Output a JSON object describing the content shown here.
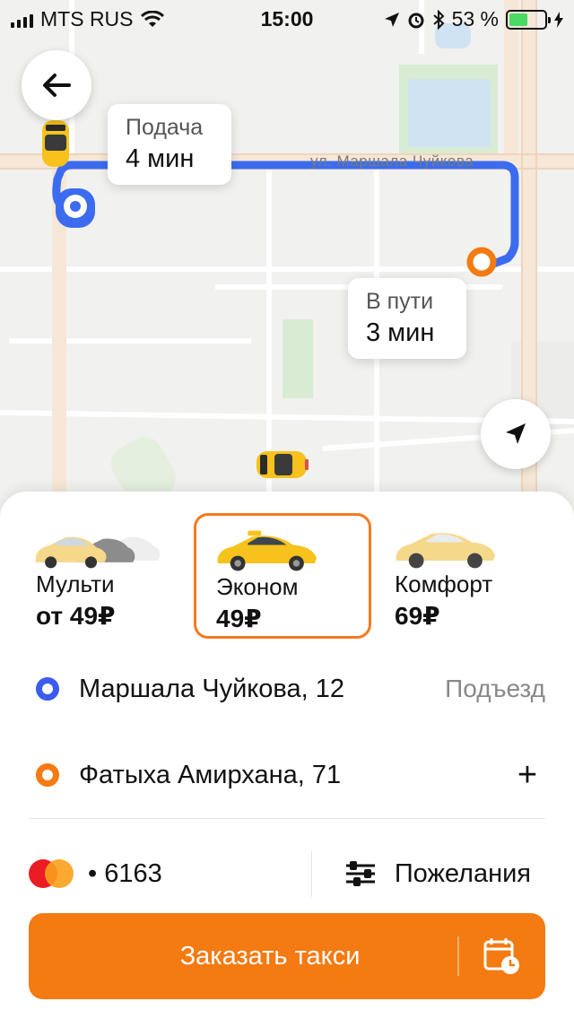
{
  "status_bar": {
    "carrier": "MTS RUS",
    "time": "15:00",
    "battery": "53 %",
    "battery_level": 0.53
  },
  "map": {
    "street_label": "ул. Маршала Чуйкова",
    "pickup_bubble": {
      "title": "Подача",
      "value": "4 мин"
    },
    "trip_bubble": {
      "title": "В пути",
      "value": "3 мин"
    },
    "route_color": "#3b6cf0",
    "origin_color": "#3b5cf0",
    "destination_color": "#f47a12"
  },
  "tariffs": [
    {
      "name": "Мульти",
      "price": "от 49₽",
      "selected": false
    },
    {
      "name": "Эконом",
      "price": "49₽",
      "selected": true
    },
    {
      "name": "Комфорт",
      "price": "69₽",
      "selected": false
    }
  ],
  "route": {
    "from": {
      "address": "Маршала Чуйкова, 12",
      "extra": "Подъезд"
    },
    "to": {
      "address": "Фатыха Амирхана, 71"
    }
  },
  "payment": {
    "card": "• 6163"
  },
  "wishes_label": "Пожелания",
  "order_button": "Заказать такси",
  "colors": {
    "accent": "#f47a12",
    "taxi_yellow": "#f7c21b"
  }
}
